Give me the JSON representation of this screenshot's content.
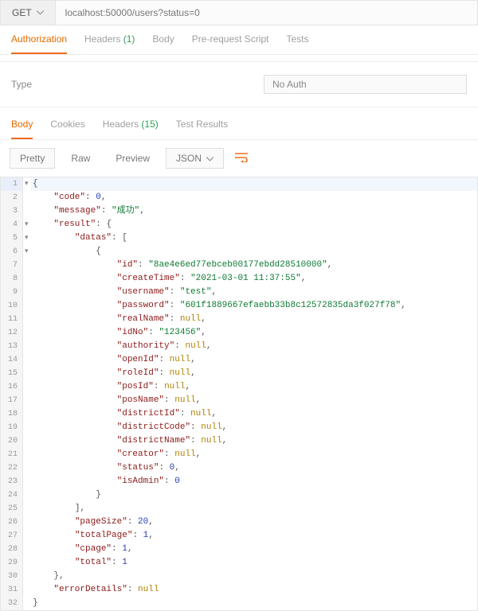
{
  "request": {
    "method": "GET",
    "url": "localhost:50000/users?status=0"
  },
  "reqTabs": {
    "authorization": "Authorization",
    "headers": "Headers",
    "headersCount": "(1)",
    "body": "Body",
    "prerequest": "Pre-request Script",
    "tests": "Tests"
  },
  "auth": {
    "typeLabel": "Type",
    "value": "No Auth"
  },
  "respTabs": {
    "body": "Body",
    "cookies": "Cookies",
    "headers": "Headers",
    "headersCount": "(15)",
    "testResults": "Test Results"
  },
  "viewer": {
    "pretty": "Pretty",
    "raw": "Raw",
    "preview": "Preview",
    "format": "JSON"
  },
  "code": {
    "l1": "{",
    "l2": "    \"code\": 0,",
    "l3": "    \"message\": \"成功\",",
    "l4": "    \"result\": {",
    "l5": "        \"datas\": [",
    "l6": "            {",
    "l7": "                \"id\": \"8ae4e6ed77ebceb00177ebdd28510000\",",
    "l8": "                \"createTime\": \"2021-03-01 11:37:55\",",
    "l9": "                \"username\": \"test\",",
    "l10": "                \"password\": \"601f1889667efaebb33b8c12572835da3f027f78\",",
    "l11": "                \"realName\": null,",
    "l12": "                \"idNo\": \"123456\",",
    "l13": "                \"authority\": null,",
    "l14": "                \"openId\": null,",
    "l15": "                \"roleId\": null,",
    "l16": "                \"posId\": null,",
    "l17": "                \"posName\": null,",
    "l18": "                \"districtId\": null,",
    "l19": "                \"districtCode\": null,",
    "l20": "                \"districtName\": null,",
    "l21": "                \"creator\": null,",
    "l22": "                \"status\": 0,",
    "l23": "                \"isAdmin\": 0",
    "l24": "            }",
    "l25": "        ],",
    "l26": "        \"pageSize\": 20,",
    "l27": "        \"totalPage\": 1,",
    "l28": "        \"cpage\": 1,",
    "l29": "        \"total\": 1",
    "l30": "    },",
    "l31": "    \"errorDetails\": null",
    "l32": "}"
  }
}
